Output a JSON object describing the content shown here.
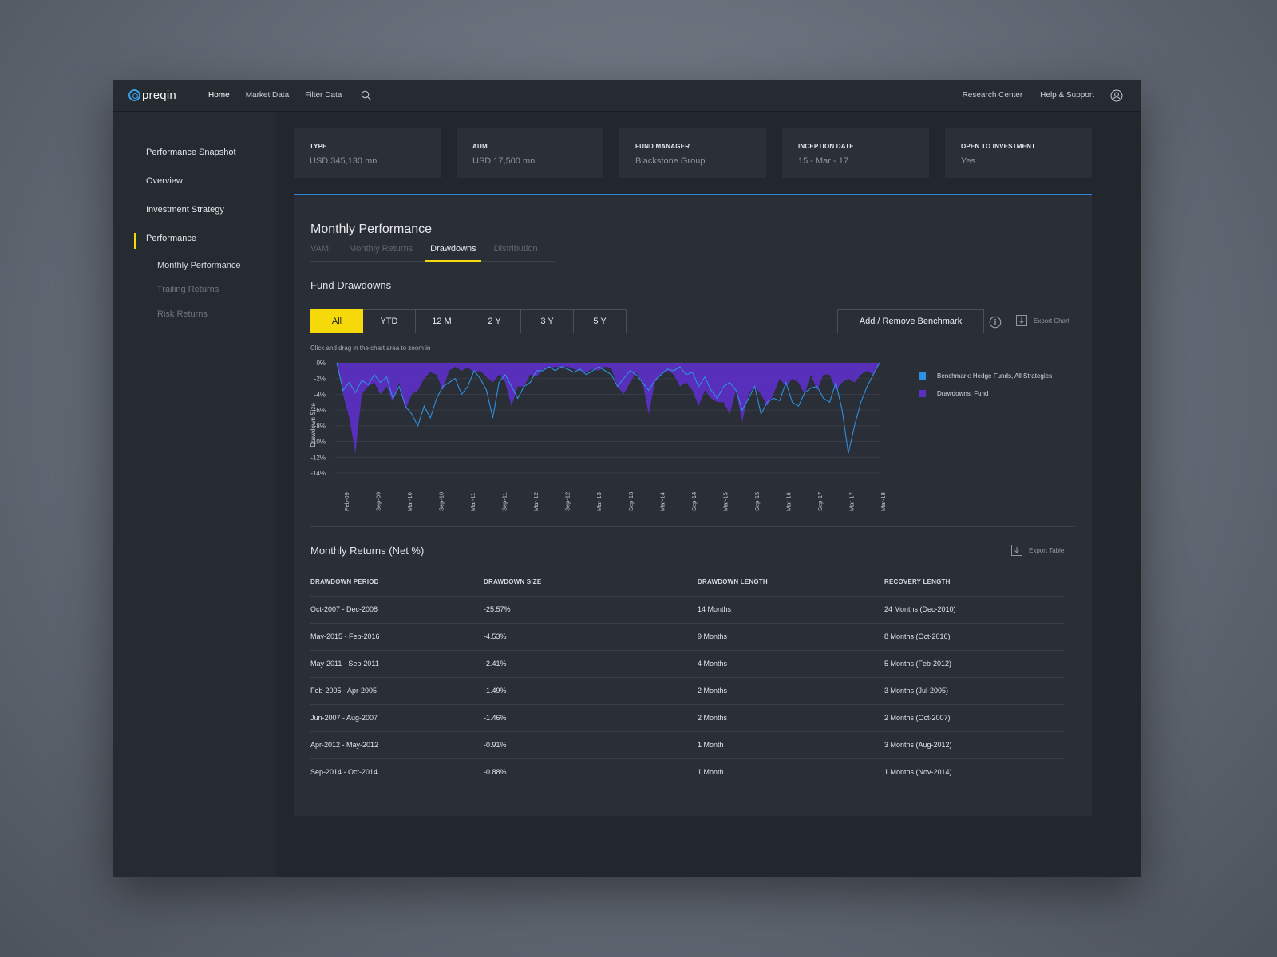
{
  "brand": {
    "name": "preqin"
  },
  "topnav": {
    "links": [
      "Home",
      "Market Data",
      "Filter Data"
    ],
    "right_links": [
      "Research Center",
      "Help & Support"
    ]
  },
  "sidebar": {
    "items": [
      "Performance Snapshot",
      "Overview",
      "Investment Strategy",
      "Performance"
    ],
    "subitems": [
      "Monthly Performance",
      "Trailing Returns",
      "Risk Returns"
    ]
  },
  "info_cards": [
    {
      "label": "TYPE",
      "value": "USD 345,130 mn"
    },
    {
      "label": "AUM",
      "value": "USD 17,500 mn"
    },
    {
      "label": "FUND MANAGER",
      "value": "Blackstone Group"
    },
    {
      "label": "INCEPTION DATE",
      "value": "15 - Mar - 17"
    },
    {
      "label": "OPEN TO INVESTMENT",
      "value": "Yes"
    }
  ],
  "panel": {
    "title": "Monthly Performance",
    "tabs": [
      "VAMI",
      "Monthly Returns",
      "Drawdowns",
      "Distribution"
    ],
    "active_tab": "Drawdowns",
    "chart_section_title": "Fund Drawdowns",
    "ranges": [
      "All",
      "YTD",
      "12 M",
      "2 Y",
      "3 Y",
      "5 Y"
    ],
    "active_range": "All",
    "benchmark_button": "Add / Remove Benchmark",
    "export_chart": "Export Chart",
    "hint": "Click and drag in the chart area to zoom in",
    "table_section_title": "Monthly Returns (Net %)",
    "export_table": "Export Table"
  },
  "colors": {
    "accent": "#f5d90a",
    "benchmark": "#2f8fe0",
    "fund": "#5b2fc2",
    "blue_rule": "#2f86d9"
  },
  "icons": [
    "search-icon",
    "user-icon",
    "info-icon",
    "download-icon"
  ],
  "chart_data": {
    "type": "area",
    "ylabel": "Drawdown Size",
    "xlabel": "",
    "ylim": [
      -14,
      0
    ],
    "yticks": [
      "0%",
      "-2%",
      "-4%",
      "-6%",
      "-8%",
      "-10%",
      "-12%",
      "-14%"
    ],
    "xticks": [
      "Feb-09",
      "Sep-09",
      "Mar-10",
      "Sep-10",
      "Mar-11",
      "Sep-11",
      "Mar-12",
      "Sep-12",
      "Mar-13",
      "Sep-13",
      "Mar-14",
      "Sep-14",
      "Mar-15",
      "Sep-15",
      "Mar-16",
      "Sep-17",
      "Mar-17",
      "Mar-18"
    ],
    "grid": true,
    "legend_position": "right",
    "series": [
      {
        "name": "Benchmark: Hedge Funds, All Strategies",
        "kind": "line",
        "values": [
          0,
          -3.5,
          -2.5,
          -3.8,
          -2.2,
          -2.8,
          -1.5,
          -2.5,
          -1.8,
          -4.5,
          -3,
          -5.5,
          -6.5,
          -8,
          -5.5,
          -7,
          -4.5,
          -3,
          -2.5,
          -2,
          -4,
          -3,
          -1,
          -2,
          -3.5,
          -7,
          -2.5,
          -1.5,
          -3,
          -4.5,
          -3,
          -2.5,
          -1,
          -1,
          -0.5,
          -1,
          -0.5,
          -0.8,
          -1.2,
          -0.8,
          -1.5,
          -1,
          -0.5,
          -1,
          -1.5,
          -3,
          -2,
          -1,
          -1.5,
          -2.5,
          -3.5,
          -2.2,
          -1.5,
          -0.8,
          -1,
          -0.5,
          -1.5,
          -1.2,
          -3,
          -1.8,
          -3.5,
          -4.5,
          -3,
          -2.5,
          -3.5,
          -6,
          -4.5,
          -3,
          -6.5,
          -5,
          -4.5,
          -4.8,
          -2.5,
          -5,
          -5.5,
          -3.8,
          -3.2,
          -3,
          -4.5,
          -5,
          -2.5,
          -6,
          -11.5,
          -8,
          -5,
          -3,
          -1.5,
          0
        ]
      },
      {
        "name": "Drawdowns: Fund",
        "kind": "area",
        "values": [
          0,
          -4,
          -7,
          -11.5,
          -4,
          -3,
          -2.5,
          -4,
          -3,
          -5,
          -2.5,
          -6,
          -4,
          -3.5,
          -2,
          -1.2,
          -1.5,
          -3.5,
          -1,
          -0.5,
          -1,
          -0.6,
          -1.2,
          -1,
          -1.8,
          -2.5,
          -1.5,
          -2.5,
          -5.5,
          -3,
          -3,
          -1.5,
          -1.8,
          -0.8,
          -0.7,
          -0.5,
          -0.6,
          -0.5,
          -0.8,
          -1,
          -1.2,
          -0.8,
          -1,
          -0.5,
          -0.7,
          -3,
          -4,
          -2.5,
          -1.2,
          -2.5,
          -6.5,
          -2.5,
          -1.5,
          -1,
          -1.5,
          -3,
          -2.5,
          -3.5,
          -5.5,
          -3.5,
          -4.5,
          -5,
          -5,
          -6.5,
          -3.5,
          -7.5,
          -4,
          -3,
          -4,
          -5.5,
          -4,
          -2,
          -3,
          -2,
          -2.5,
          -4,
          -1.5,
          -3.5,
          -1.5,
          -1.5,
          -3.5,
          -2.5,
          -2,
          -2.5,
          -1.5,
          -1,
          -1.5,
          0
        ]
      }
    ]
  },
  "table": {
    "columns": [
      "DRAWDOWN PERIOD",
      "DRAWDOWN SIZE",
      "DRAWDOWN LENGTH",
      "RECOVERY LENGTH"
    ],
    "rows": [
      [
        "Oct-2007 - Dec-2008",
        "-25.57%",
        "14 Months",
        "24 Months (Dec-2010)"
      ],
      [
        "May-2015 - Feb-2016",
        "-4.53%",
        "9 Months",
        "8 Months (Oct-2016)"
      ],
      [
        "May-2011 - Sep-2011",
        "-2.41%",
        "4 Months",
        "5 Months (Feb-2012)"
      ],
      [
        "Feb-2005 - Apr-2005",
        "-1.49%",
        "2 Months",
        "3 Months (Jul-2005)"
      ],
      [
        "Jun-2007 - Aug-2007",
        "-1.46%",
        "2 Months",
        "2 Months (Oct-2007)"
      ],
      [
        "Apr-2012 - May-2012",
        "-0.91%",
        "1 Month",
        "3 Months (Aug-2012)"
      ],
      [
        "Sep-2014 - Oct-2014",
        "-0.88%",
        "1 Month",
        "1 Months (Nov-2014)"
      ]
    ]
  }
}
